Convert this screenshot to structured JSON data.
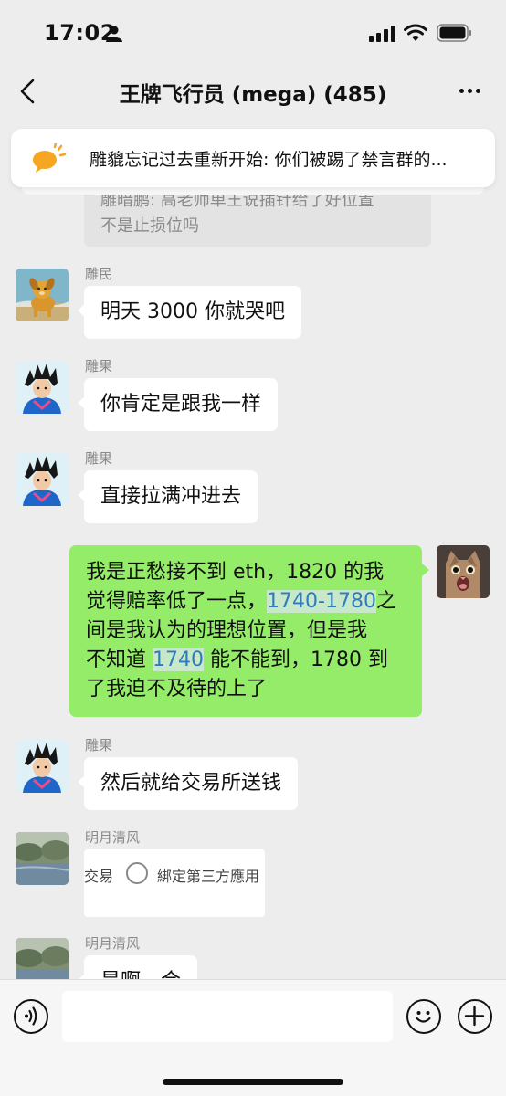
{
  "status_bar": {
    "time": "17:02"
  },
  "header": {
    "title": "王牌飞行员 (mega) (485)"
  },
  "notice": {
    "text": "雕貔忘记过去重新开始: 你们被踢了禁言群的..."
  },
  "partial_message": {
    "line1": "雕暗鹏: 高老师单王说插针给了好位置",
    "line2": "不是止损位吗"
  },
  "messages": [
    {
      "sender": "雕民",
      "text": "明天 3000 你就哭吧"
    },
    {
      "sender": "雕果",
      "text": "你肯定是跟我一样"
    },
    {
      "sender": "雕果",
      "text": "直接拉满冲进去"
    },
    {
      "sender": "",
      "self": true,
      "line1": "我是正愁接不到 eth，1820 的我",
      "line2_pre": "觉得赔率低了一点，",
      "line2_hl1": "1740",
      "line2_dash": "-",
      "line2_hl2": "1780",
      "line2_post": "之",
      "line3": "间是我认为的理想位置，但是我",
      "line4_pre": "不知道 ",
      "line4_hl": "1740",
      "line4_post": " 能不能到，1780 到",
      "line5": "了我迫不及待的上了"
    },
    {
      "sender": "雕果",
      "text": "然后就给交易所送钱"
    },
    {
      "sender": "明月清风",
      "image_text1": "交易",
      "image_text2": "綁定第三方應用"
    },
    {
      "sender": "明月清风",
      "text": "是啊，合"
    }
  ],
  "colors": {
    "self_bubble": "#95ec69",
    "link": "#2f7bbf",
    "background": "#ededed"
  }
}
